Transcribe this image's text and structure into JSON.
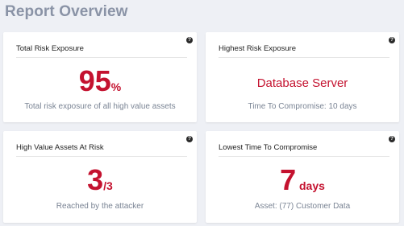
{
  "page": {
    "title": "Report Overview"
  },
  "colors": {
    "accent": "#c4122f",
    "title": "#8a93a6",
    "caption": "#7a8494",
    "background": "#eef0f5"
  },
  "cards": {
    "total_risk": {
      "title": "Total Risk Exposure",
      "value": "95",
      "unit": "%",
      "caption": "Total risk exposure of all high value assets",
      "help_icon": "help-icon"
    },
    "highest_risk": {
      "title": "Highest Risk Exposure",
      "value": "Database Server",
      "caption": "Time To Compromise: 10 days",
      "help_icon": "help-icon"
    },
    "assets_at_risk": {
      "title": "High Value Assets At Risk",
      "value": "3",
      "unit": "/3",
      "caption": "Reached by the attacker",
      "help_icon": "help-icon"
    },
    "lowest_ttc": {
      "title": "Lowest Time To Compromise",
      "value": "7",
      "unit": " days",
      "caption": "Asset: (77) Customer Data",
      "help_icon": "help-icon"
    }
  }
}
